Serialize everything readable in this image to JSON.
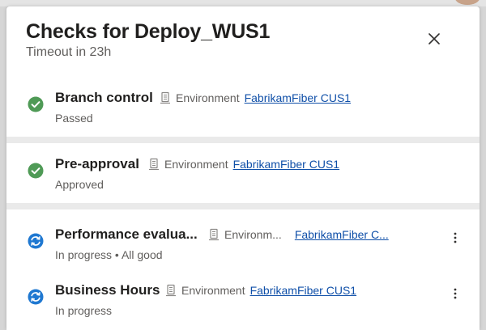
{
  "panel": {
    "title": "Checks for Deploy_WUS1",
    "subtitle": "Timeout in 23h"
  },
  "colors": {
    "success": "#4f9a56",
    "in_progress": "#1f78d1",
    "link": "#0f4fa8",
    "separator": "#eaeaea"
  },
  "checks": [
    {
      "name": "Branch control",
      "status": "Passed",
      "env_label": "Environment",
      "env_link": "FabrikamFiber CUS1",
      "status_icon": "check-circle-icon"
    },
    {
      "name": "Pre-approval",
      "status": "Approved",
      "env_label": "Environment",
      "env_link": "FabrikamFiber CUS1",
      "status_icon": "check-circle-icon"
    },
    {
      "name": "Performance evalua...",
      "status": "In progress • All good",
      "env_label": "Environm...",
      "env_link": "FabrikamFiber C...",
      "status_icon": "in-progress-icon"
    },
    {
      "name": "Business Hours",
      "status": "In progress",
      "env_label": "Environment",
      "env_link": "FabrikamFiber CUS1",
      "status_icon": "in-progress-icon"
    }
  ]
}
